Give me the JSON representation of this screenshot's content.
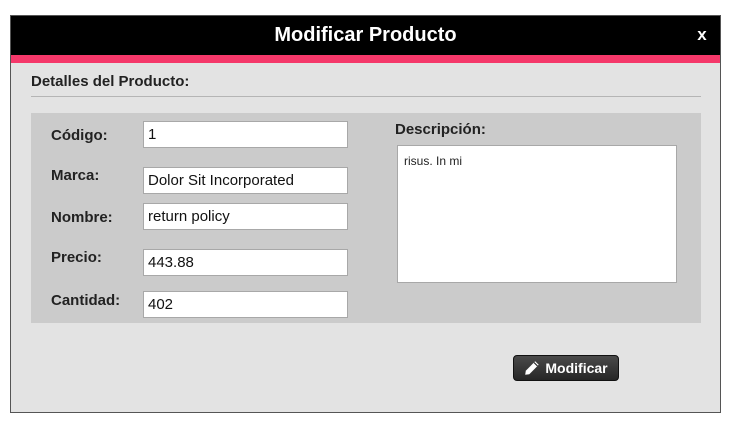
{
  "dialog": {
    "title": "Modificar Producto",
    "close_label": "x",
    "section_title": "Detalles del Producto:"
  },
  "fields": {
    "codigo": {
      "label": "Código:",
      "value": "1"
    },
    "marca": {
      "label": "Marca:",
      "value": "Dolor Sit Incorporated"
    },
    "nombre": {
      "label": "Nombre:",
      "value": "return policy"
    },
    "precio": {
      "label": "Precio:",
      "value": "443.88"
    },
    "cantidad": {
      "label": "Cantidad:",
      "value": "402"
    }
  },
  "descripcion": {
    "label": "Descripción:",
    "value": "risus. In mi"
  },
  "actions": {
    "modify_label": "Modificar",
    "modify_icon": "pencil-icon"
  },
  "colors": {
    "titlebar": "#000000",
    "accent": "#f5386a",
    "dialog_bg": "#e3e3e3",
    "panel_bg": "#cbcbcb",
    "button_bg": "#262626"
  }
}
